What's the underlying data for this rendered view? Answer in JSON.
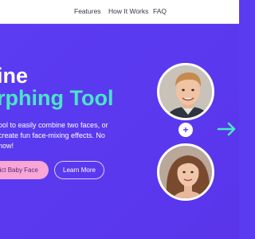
{
  "nav": {
    "items": [
      "Features",
      "How It Works",
      "FAQ"
    ]
  },
  "hero": {
    "title_line1": "ine",
    "title_line2": "rphing Tool",
    "description": "ool to easily combine two faces, or create fun face-mixing effects. No now!",
    "primary_button": "dict Baby Face",
    "secondary_button": "Learn More",
    "plus_symbol": "+"
  },
  "colors": {
    "background": "#5a3bf0",
    "accent_teal": "#49e6c6",
    "button_pink": "#f7a6d6"
  },
  "icons": {
    "arrow": "arrow-right-icon"
  }
}
